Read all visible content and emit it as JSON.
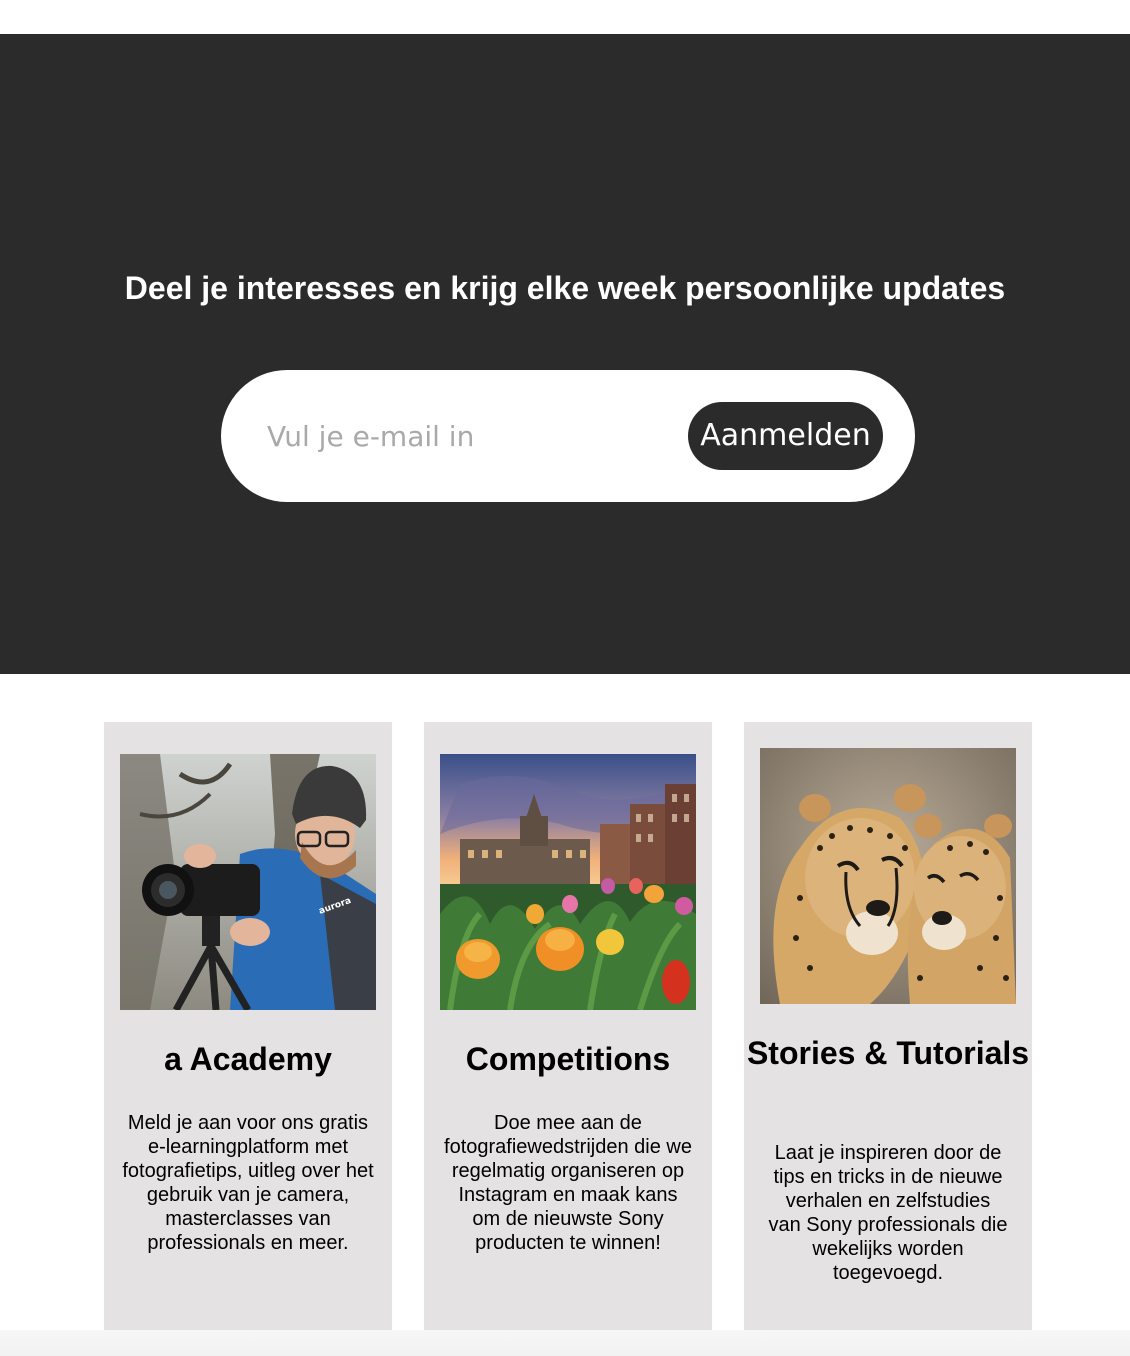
{
  "hero": {
    "title": "Deel je interesses en krijg elke week persoonlijke updates",
    "email_placeholder": "Vul je e-mail in",
    "signup_label": "Aanmelden",
    "background_color": "#2b2b2b"
  },
  "cards": [
    {
      "title": "a Academy",
      "text": "Meld je aan voor ons gratis e-learningplatform met fotografietips, uitleg over het gebruik van je camera, masterclasses van professionals en meer.",
      "image": "photographer-with-camera"
    },
    {
      "title": "Competitions",
      "text": "Doe mee aan de fotografiewedstrijden die we regelmatig organiseren op Instagram en maak kans om de nieuwste Sony producten te winnen!",
      "image": "tulips-in-city-square"
    },
    {
      "title": "Stories & Tutorials",
      "text": "Laat je inspireren door de tips en tricks in de nieuwe verhalen en zelfstudies van Sony professionals die wekelijks worden toegevoegd.",
      "image": "two-cheetahs"
    }
  ],
  "colors": {
    "card_background": "#e4e2e3",
    "button_background": "#2b2b2b"
  }
}
